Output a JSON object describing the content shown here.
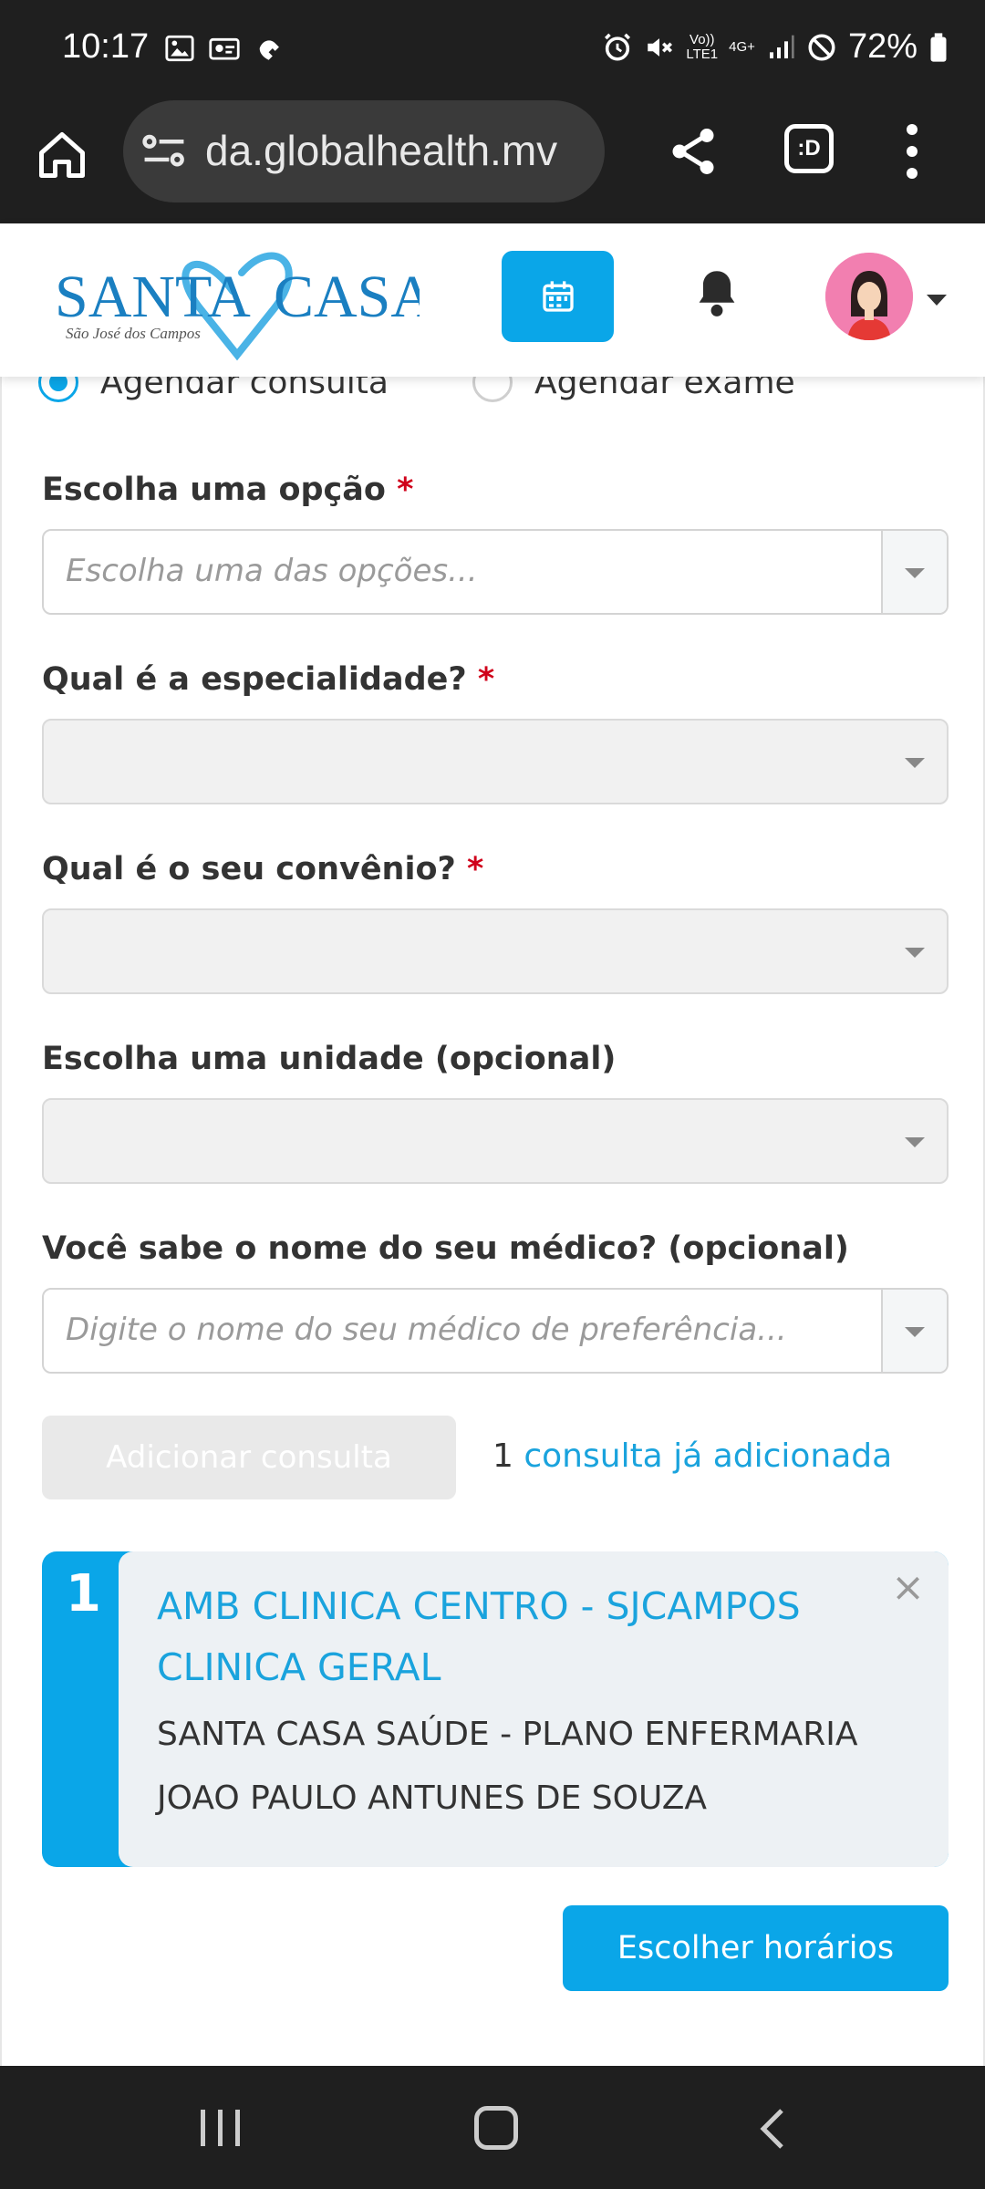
{
  "status_bar": {
    "time": "10:17",
    "volte_top": "Vo))",
    "volte_bottom": "LTE1",
    "network": "4G+",
    "battery": "72%"
  },
  "browser": {
    "url": "da.globalhealth.mv",
    "tabs_icon_label": ":D"
  },
  "header": {
    "logo_text_left": "SANTA",
    "logo_text_right": "CASA",
    "logo_subtitle": "São José dos Campos"
  },
  "form": {
    "radio_consulta": "Agendar consulta",
    "radio_exame": "Agendar exame",
    "option_label": "Escolha uma opção",
    "option_placeholder": "Escolha uma das opções...",
    "specialty_label": "Qual é a especialidade?",
    "insurance_label": "Qual é o seu convênio?",
    "unit_label": "Escolha uma unidade (opcional)",
    "doctor_label": "Você sabe o nome do seu médico? (opcional)",
    "doctor_placeholder": "Digite o nome do seu médico de preferência...",
    "required_mark": "*",
    "add_button": "Adicionar consulta",
    "added_count": "1",
    "added_text": "consulta já adicionada"
  },
  "appointment": {
    "number": "1",
    "location": "AMB CLINICA CENTRO - SJCAMPOS",
    "specialty": "CLINICA GERAL",
    "plan": "SANTA CASA SAÚDE - PLANO ENFERMARIA",
    "doctor": "JOAO PAULO ANTUNES DE SOUZA",
    "close_symbol": "×"
  },
  "actions": {
    "choose_times": "Escolher horários"
  },
  "colors": {
    "accent": "#0aa6e8",
    "link": "#1aa3dd",
    "required": "#d0021b"
  }
}
